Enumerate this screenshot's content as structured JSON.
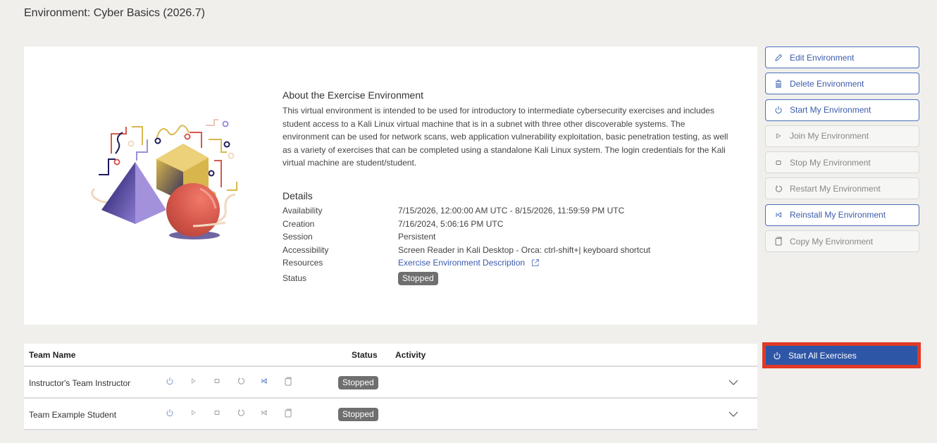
{
  "page": {
    "title": "Environment: Cyber Basics (2026.7)"
  },
  "about": {
    "heading": "About the Exercise Environment",
    "description": "This virtual environment is intended to be used for introductory to intermediate cybersecurity exercises and includes student access to a Kali Linux virtual machine that is in a subnet with three other discoverable systems. The environment can be used for network scans, web application vulnerability exploitation, basic penetration testing, as well as a variety of exercises that can be completed using a standalone Kali Linux system. The login credentials for the Kali virtual machine are student/student."
  },
  "details": {
    "heading": "Details",
    "rows": [
      {
        "label": "Availability",
        "value": "7/15/2026, 12:00:00 AM UTC - 8/15/2026, 11:59:59 PM UTC"
      },
      {
        "label": "Creation",
        "value": "7/16/2024, 5:06:16 PM UTC"
      },
      {
        "label": "Session",
        "value": "Persistent"
      },
      {
        "label": "Accessibility",
        "value": "Screen Reader in Kali Desktop - Orca: ctrl-shift+| keyboard shortcut"
      },
      {
        "label": "Resources",
        "value": "Exercise Environment Description",
        "icon": "external-link-icon"
      },
      {
        "label": "Status",
        "value": "Stopped"
      }
    ]
  },
  "actions": [
    {
      "label": "Edit Environment",
      "icon": "pencil-icon",
      "enabled": true
    },
    {
      "label": "Delete Environment",
      "icon": "trash-icon",
      "enabled": true
    },
    {
      "label": "Start My Environment",
      "icon": "power-icon",
      "enabled": true
    },
    {
      "label": "Join My Environment",
      "icon": "play-icon",
      "enabled": false
    },
    {
      "label": "Stop My Environment",
      "icon": "stop-icon",
      "enabled": false
    },
    {
      "label": "Restart My Environment",
      "icon": "restart-icon",
      "enabled": false
    },
    {
      "label": "Reinstall My Environment",
      "icon": "reinstall-icon",
      "enabled": true
    },
    {
      "label": "Copy My Environment",
      "icon": "copy-icon",
      "enabled": false
    }
  ],
  "teams_table": {
    "columns": [
      "Team Name",
      "Status",
      "Activity"
    ],
    "rows": [
      {
        "name": "Instructor's Team Instructor",
        "status": "Stopped",
        "activity": ""
      },
      {
        "name": "Team Example Student",
        "status": "Stopped",
        "activity": ""
      }
    ]
  },
  "start_all": {
    "label": "Start All Exercises",
    "icon": "power-icon"
  },
  "colors": {
    "accent": "#2e56a6",
    "link": "#3b5bab",
    "highlight_border": "#e03a26",
    "badge": "#6f6f6f",
    "background": "#f0efec"
  }
}
